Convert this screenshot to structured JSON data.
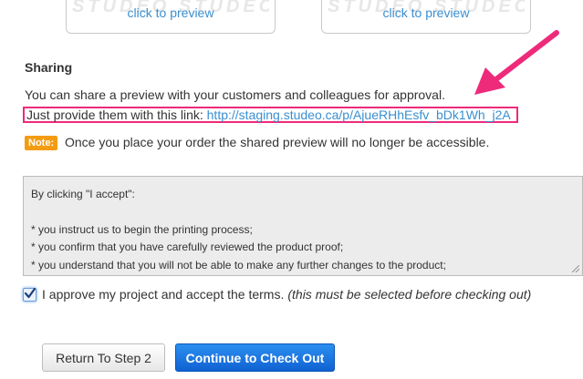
{
  "previews": [
    {
      "link_text": "click to preview",
      "watermark": "STUDEO STUDEO"
    },
    {
      "link_text": "click to preview",
      "watermark": "STUDEO STUDEO"
    }
  ],
  "sharing": {
    "title": "Sharing",
    "description": "You can share a preview with your customers and colleagues for approval.",
    "link_prefix": "Just provide them with this link: ",
    "link_url": "http://staging.studeo.ca/p/AjueRHhEsfv_bDk1Wh_j2A",
    "note_badge": "Note:",
    "note_text": " Once you place your order the shared preview will no longer be accessible."
  },
  "terms": {
    "text": "By clicking \"I accept\":\n\n* you instruct us to begin the printing process;\n* you confirm that you have carefully reviewed the product proof;\n* you understand that you will not be able to make any further changes to the product;"
  },
  "approval": {
    "checked": true,
    "label": "I approve my project and accept the terms.",
    "note": "(this must be selected before checking out)"
  },
  "buttons": {
    "return_label": "Return To Step 2",
    "continue_label": "Continue to Check Out"
  },
  "colors": {
    "highlight_border": "#ee2a7b",
    "arrow": "#ee2a7b",
    "link": "#3a8fd0",
    "note_badge": "#f39c12",
    "primary_button": "#1a6fdc"
  },
  "icons": {
    "annotation_arrow": "arrow-down-left-icon",
    "checkmark": "checkmark-icon"
  }
}
